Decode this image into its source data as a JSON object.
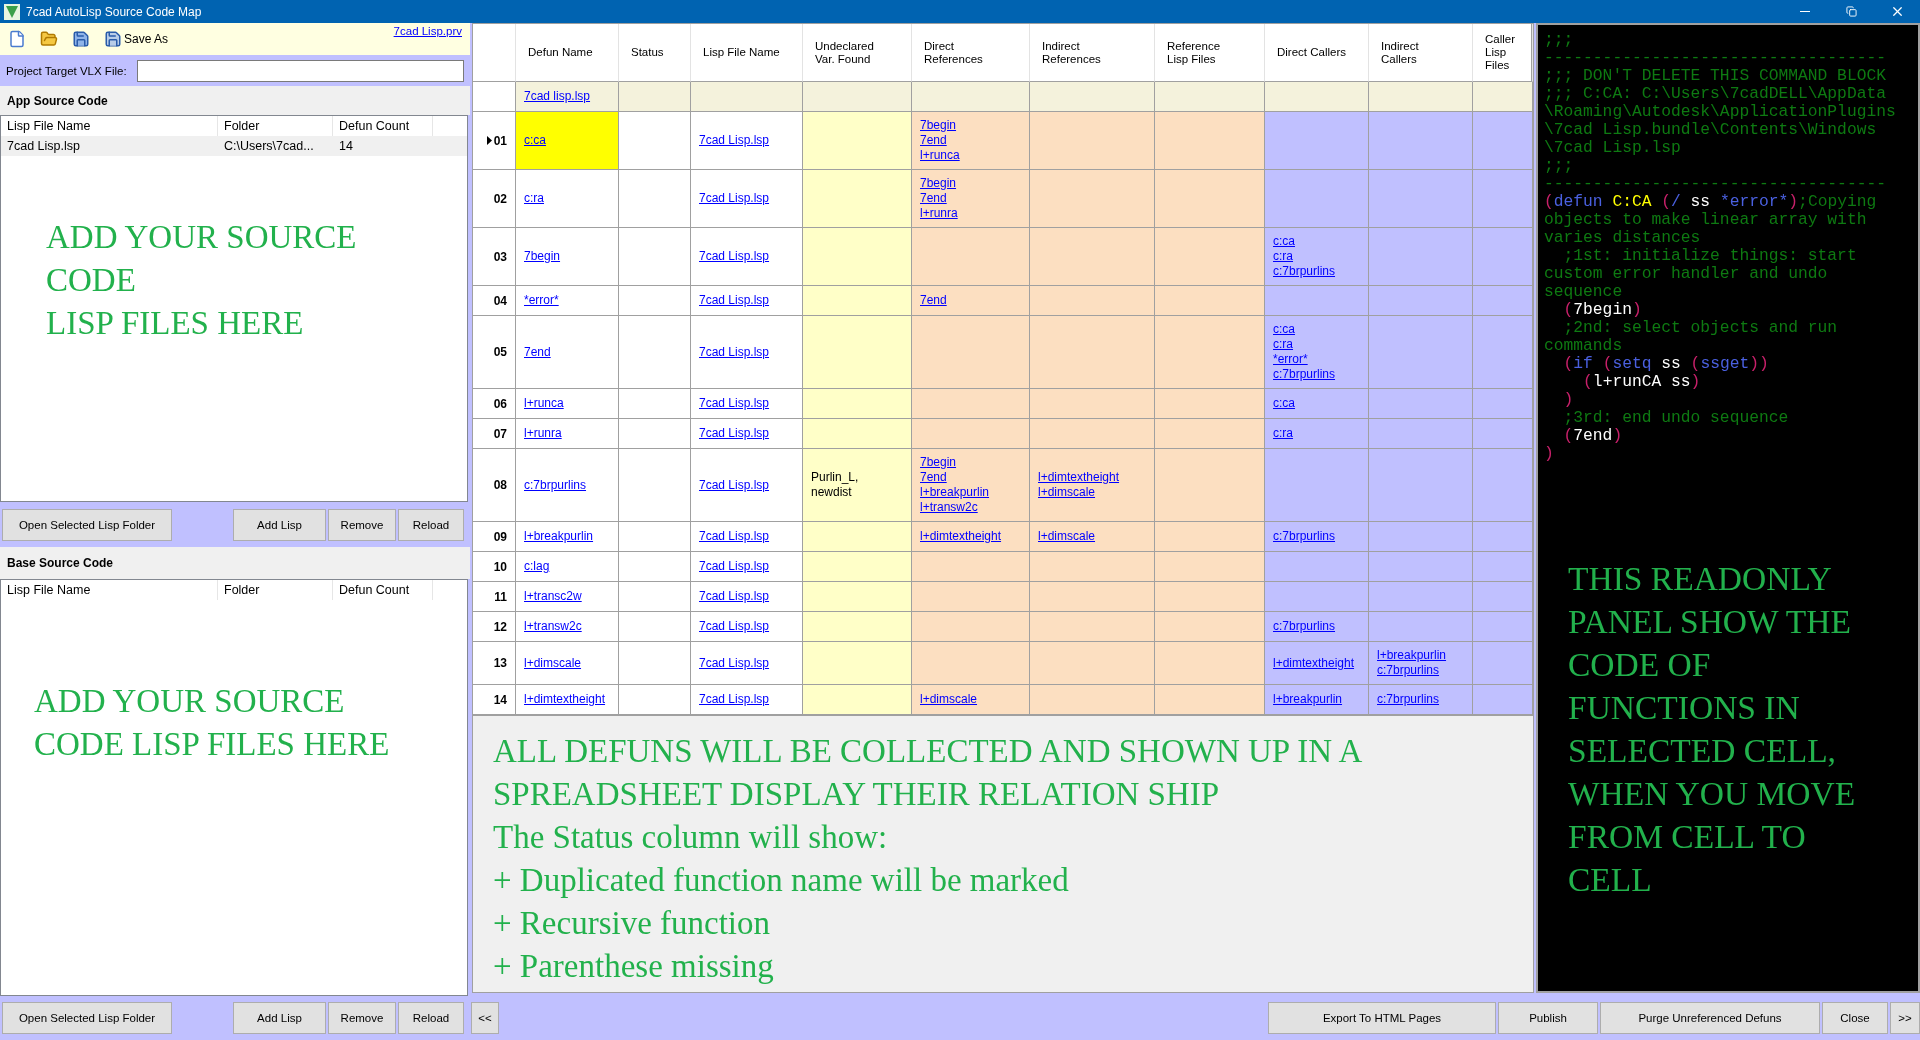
{
  "window": {
    "title": "7cad AutoLisp Source Code Map"
  },
  "toolbar": {
    "save_as": "Save As",
    "project_link": "7cad Lisp.prv"
  },
  "project_target": {
    "label": "Project Target VLX File:"
  },
  "app_source": {
    "title": "App Source Code",
    "columns": [
      "Lisp File Name",
      "Folder",
      "Defun Count"
    ],
    "rows": [
      {
        "cells": [
          "7cad Lisp.lsp",
          "C:\\Users\\7cad...",
          "14"
        ],
        "selected": true
      }
    ],
    "hint": "ADD YOUR SOURCE\nCODE\nLISP FILES HERE",
    "buttons": [
      "Open Selected Lisp Folder",
      "Add Lisp",
      "Remove",
      "Reload"
    ]
  },
  "base_source": {
    "title": "Base Source Code",
    "columns": [
      "Lisp File Name",
      "Folder",
      "Defun Count"
    ],
    "hint": "ADD YOUR SOURCE\nCODE LISP FILES HERE",
    "buttons": [
      "Open Selected Lisp Folder",
      "Add Lisp",
      "Remove",
      "Reload"
    ]
  },
  "grid": {
    "columns": [
      {
        "label": "Defun Name",
        "kind": "name"
      },
      {
        "label": "Status",
        "kind": "status"
      },
      {
        "label": "Lisp File Name",
        "kind": "file"
      },
      {
        "label": "Undeclared\nVar. Found",
        "kind": "undeclared"
      },
      {
        "label": "Direct\nReferences",
        "kind": "references"
      },
      {
        "label": "Indirect\nReferences",
        "kind": "references"
      },
      {
        "label": "Reference\nLisp Files",
        "kind": "references"
      },
      {
        "label": "Direct Callers",
        "kind": "callers"
      },
      {
        "label": "Indirect\nCallers",
        "kind": "callers"
      },
      {
        "label": "Caller\nLisp\nFiles",
        "kind": "callers"
      }
    ],
    "filter_row": {
      "defun_name": "7cad lisp.lsp"
    },
    "rows": [
      {
        "number": "01",
        "selected": true,
        "defun_name": "c:ca",
        "lisp_file_name": "7cad Lisp.lsp",
        "direct_references": [
          "7begin",
          "7end",
          "l+runca"
        ]
      },
      {
        "number": "02",
        "selected": false,
        "defun_name": "c:ra",
        "lisp_file_name": "7cad Lisp.lsp",
        "direct_references": [
          "7begin",
          "7end",
          "l+runra"
        ]
      },
      {
        "number": "03",
        "selected": false,
        "defun_name": "7begin",
        "lisp_file_name": "7cad Lisp.lsp",
        "direct_callers": [
          "c:ca",
          "c:ra",
          "c:7brpurlins"
        ]
      },
      {
        "number": "04",
        "selected": false,
        "defun_name": "*error*",
        "lisp_file_name": "7cad Lisp.lsp",
        "direct_references": [
          "7end"
        ]
      },
      {
        "number": "05",
        "selected": false,
        "defun_name": "7end",
        "lisp_file_name": "7cad Lisp.lsp",
        "direct_callers": [
          "c:ca",
          "c:ra",
          "*error*",
          "c:7brpurlins"
        ]
      },
      {
        "number": "06",
        "selected": false,
        "defun_name": "l+runca",
        "lisp_file_name": "7cad Lisp.lsp",
        "direct_callers": [
          "c:ca"
        ]
      },
      {
        "number": "07",
        "selected": false,
        "defun_name": "l+runra",
        "lisp_file_name": "7cad Lisp.lsp",
        "direct_callers": [
          "c:ra"
        ]
      },
      {
        "number": "08",
        "selected": false,
        "defun_name": "c:7brpurlins",
        "lisp_file_name": "7cad Lisp.lsp",
        "undeclared_vars": "Purlin_L,\nnewdist",
        "direct_references": [
          "7begin",
          "7end",
          "l+breakpurlin",
          "l+transw2c"
        ],
        "indirect_references": [
          "l+dimtextheight",
          "l+dimscale"
        ]
      },
      {
        "number": "09",
        "selected": false,
        "defun_name": "l+breakpurlin",
        "lisp_file_name": "7cad Lisp.lsp",
        "direct_references": [
          "l+dimtextheight"
        ],
        "indirect_references": [
          "l+dimscale"
        ],
        "direct_callers": [
          "c:7brpurlins"
        ]
      },
      {
        "number": "10",
        "selected": false,
        "defun_name": "c:lag",
        "lisp_file_name": "7cad Lisp.lsp"
      },
      {
        "number": "11",
        "selected": false,
        "defun_name": "l+transc2w",
        "lisp_file_name": "7cad Lisp.lsp"
      },
      {
        "number": "12",
        "selected": false,
        "defun_name": "l+transw2c",
        "lisp_file_name": "7cad Lisp.lsp",
        "direct_callers": [
          "c:7brpurlins"
        ]
      },
      {
        "number": "13",
        "selected": false,
        "defun_name": "l+dimscale",
        "lisp_file_name": "7cad Lisp.lsp",
        "direct_callers": [
          "l+dimtextheight"
        ],
        "indirect_callers": [
          "l+breakpurlin",
          "c:7brpurlins"
        ]
      },
      {
        "number": "14",
        "selected": false,
        "defun_name": "l+dimtextheight",
        "lisp_file_name": "7cad Lisp.lsp",
        "direct_references": [
          "l+dimscale"
        ],
        "direct_callers": [
          "l+breakpurlin"
        ],
        "indirect_callers": [
          "c:7brpurlins"
        ]
      }
    ]
  },
  "grid_note": "ALL DEFUNS WILL BE COLLECTED AND SHOWN UP IN A\nSPREADSHEET DISPLAY THEIR RELATION SHIP\nThe Status column will show:\n+ Duplicated function name will be marked\n+ Recursive function\n+ Parenthese missing",
  "code_panel": {
    "lines": [
      [
        {
          "text": ";;;",
          "kind": "comment"
        }
      ],
      [
        {
          "text": "-----------------------------------",
          "kind": "comment"
        }
      ],
      [
        {
          "text": ";;; DON'T DELETE THIS COMMAND BLOCK",
          "kind": "comment"
        }
      ],
      [
        {
          "text": ";;; C:CA: C:\\Users\\7cadDELL\\AppData",
          "kind": "comment"
        }
      ],
      [
        {
          "text": "\\Roaming\\Autodesk\\ApplicationPlugins",
          "kind": "comment"
        }
      ],
      [
        {
          "text": "\\7cad Lisp.bundle\\Contents\\Windows",
          "kind": "comment"
        }
      ],
      [
        {
          "text": "\\7cad Lisp.lsp",
          "kind": "comment"
        }
      ],
      [
        {
          "text": ";;;",
          "kind": "comment"
        }
      ],
      [
        {
          "text": "-----------------------------------",
          "kind": "comment"
        }
      ],
      [
        {
          "text": "(",
          "kind": "paren"
        },
        {
          "text": "defun ",
          "kind": "keyword"
        },
        {
          "text": "C:CA ",
          "kind": "name"
        },
        {
          "text": "(",
          "kind": "paren"
        },
        {
          "text": "/",
          "kind": "keyword"
        },
        {
          "text": " ss ",
          "kind": "plain"
        },
        {
          "text": "*error*",
          "kind": "keyword"
        },
        {
          "text": ")",
          "kind": "paren"
        },
        {
          "text": ";Copying",
          "kind": "comment"
        }
      ],
      [
        {
          "text": "objects to make linear array with",
          "kind": "comment"
        }
      ],
      [
        {
          "text": "varies distances",
          "kind": "comment"
        }
      ],
      [
        {
          "text": "  ;1st: initialize things: start",
          "kind": "comment"
        }
      ],
      [
        {
          "text": "custom error handler and undo",
          "kind": "comment"
        }
      ],
      [
        {
          "text": "sequence",
          "kind": "comment"
        }
      ],
      [
        {
          "text": "  (",
          "kind": "paren"
        },
        {
          "text": "7begin",
          "kind": "plain"
        },
        {
          "text": ")",
          "kind": "paren"
        }
      ],
      [
        {
          "text": "  ;2nd: select objects and run",
          "kind": "comment"
        }
      ],
      [
        {
          "text": "commands",
          "kind": "comment"
        }
      ],
      [
        {
          "text": "  (",
          "kind": "paren"
        },
        {
          "text": "if ",
          "kind": "keyword"
        },
        {
          "text": "(",
          "kind": "paren"
        },
        {
          "text": "setq",
          "kind": "keyword"
        },
        {
          "text": " ss ",
          "kind": "plain"
        },
        {
          "text": "(",
          "kind": "paren"
        },
        {
          "text": "ssget",
          "kind": "keyword"
        },
        {
          "text": "))",
          "kind": "paren"
        }
      ],
      [
        {
          "text": "    (",
          "kind": "paren"
        },
        {
          "text": "l+runCA ss",
          "kind": "plain"
        },
        {
          "text": ")",
          "kind": "paren"
        }
      ],
      [
        {
          "text": "  )",
          "kind": "paren"
        }
      ],
      [
        {
          "text": "  ;3rd: end undo sequence",
          "kind": "comment"
        }
      ],
      [
        {
          "text": "  (",
          "kind": "paren"
        },
        {
          "text": "7end",
          "kind": "plain"
        },
        {
          "text": ")",
          "kind": "paren"
        }
      ],
      [
        {
          "text": ")",
          "kind": "paren"
        }
      ]
    ],
    "note": "THIS READONLY\nPANEL SHOW THE\nCODE OF\nFUNCTIONS IN\nSELECTED CELL,\nWHEN YOU MOVE\nFROM CELL TO\nCELL"
  },
  "bottom_bar": {
    "left": [
      "<<"
    ],
    "right": [
      "Export To HTML Pages",
      "Publish",
      "Purge Unreferenced Defuns",
      "Close",
      ">>"
    ]
  }
}
